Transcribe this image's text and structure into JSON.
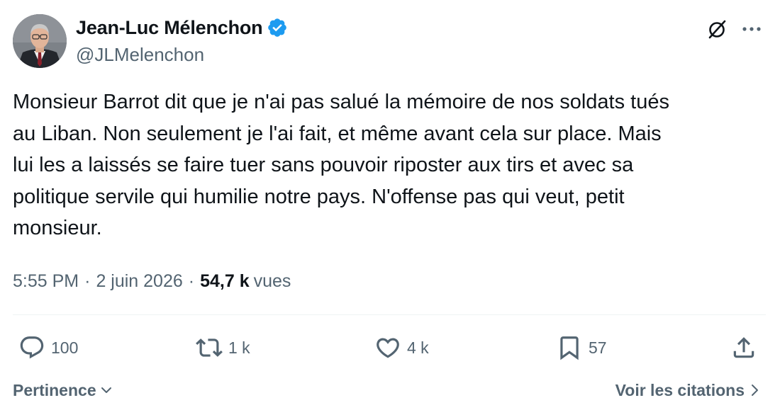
{
  "author": {
    "display_name": "Jean-Luc Mélenchon",
    "handle": "@JLMelenchon",
    "verified": true,
    "verified_color": "#1d9bf0"
  },
  "header_icons": {
    "grok": "grok-icon",
    "more": "more-icon"
  },
  "tweet": {
    "text": "Monsieur Barrot dit que je n'ai pas salué la mémoire de nos soldats tués\nau Liban. Non seulement je l'ai fait, et même avant cela sur place. Mais\nlui les a laissés se faire tuer sans pouvoir riposter aux tirs et avec sa\npolitique servile qui humilie notre pays. N'offense pas qui veut, petit\nmonsieur."
  },
  "meta": {
    "time": "5:55 PM",
    "separator": "·",
    "date": "2 juin 2026",
    "views_count": "54,7 k",
    "views_label": "vues"
  },
  "actions": {
    "reply": {
      "icon": "reply-icon",
      "count": "100"
    },
    "retweet": {
      "icon": "retweet-icon",
      "count": "1 k"
    },
    "like": {
      "icon": "heart-icon",
      "count": "4 k"
    },
    "bookmark": {
      "icon": "bookmark-icon",
      "count": "57"
    },
    "share": {
      "icon": "share-icon"
    }
  },
  "footer": {
    "sort_label": "Pertinence",
    "quotes_label": "Voir les citations"
  },
  "colors": {
    "text_primary": "#0f1419",
    "text_secondary": "#536471",
    "divider": "#eff3f4",
    "accent": "#1d9bf0"
  }
}
